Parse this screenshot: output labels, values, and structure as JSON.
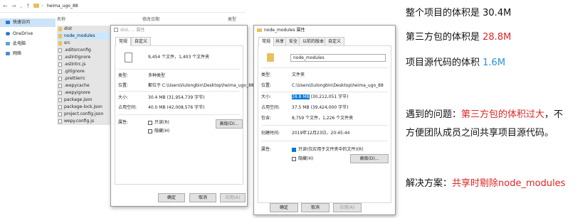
{
  "explorer": {
    "path": "heima_ugo_88",
    "columns": [
      "名称",
      "修改日期",
      "类型"
    ],
    "nav": [
      {
        "label": "快速访问",
        "color": "#2b79d0"
      },
      {
        "label": "OneDrive",
        "color": "#2b79d0"
      },
      {
        "label": "此电脑",
        "color": "#5aa0e6"
      },
      {
        "label": "网络",
        "color": "#4a8bd6"
      }
    ],
    "files": [
      {
        "name": "dist",
        "kind": "folder"
      },
      {
        "name": "node_modules",
        "kind": "folder"
      },
      {
        "name": "src",
        "kind": "folder"
      },
      {
        "name": ".editorconfig",
        "kind": "file"
      },
      {
        "name": ".eslintignore",
        "kind": "file"
      },
      {
        "name": ".eslintrc.js",
        "kind": "file"
      },
      {
        "name": ".gitignore",
        "kind": "file"
      },
      {
        "name": ".prettierrc",
        "kind": "file"
      },
      {
        "name": ".wepycache",
        "kind": "file"
      },
      {
        "name": ".wepyignore",
        "kind": "file"
      },
      {
        "name": "package.json",
        "kind": "file"
      },
      {
        "name": "package-lock.json",
        "kind": "file"
      },
      {
        "name": "project.config.json",
        "kind": "file"
      },
      {
        "name": "wepy.config.js",
        "kind": "file"
      }
    ]
  },
  "dialog1": {
    "title": "dist, ... 属性",
    "tabs": [
      "常规",
      "自定义"
    ],
    "summary": "9,454 个文件，1,403 个文件夹",
    "type_label": "类型:",
    "type_value": "多种类型",
    "location_label": "位置:",
    "location_value": "都位于 C:\\Users\\liulongbin\\Desktop\\heima_ugo_88",
    "size_label": "大小:",
    "size_value": "30.4 MB (31,954,739 字节)",
    "disk_label": "占用空间:",
    "disk_value": "40.0 MB (42,008,576 字节)",
    "attr_label": "属性:",
    "readonly": "只读(R)",
    "hidden": "隐藏(H)",
    "advanced": "高级(D)...",
    "ok": "确定",
    "cancel": "取消",
    "apply": "应用(A)"
  },
  "dialog2": {
    "title": "node_modules 属性",
    "tabs": [
      "常规",
      "共享",
      "安全",
      "以前的版本",
      "自定义"
    ],
    "name_value": "node_modules",
    "type_label": "类型:",
    "type_value": "文件夹",
    "location_label": "位置:",
    "location_value": "C:\\Users\\liulongbin\\Desktop\\heima_ugo_88",
    "size_label": "大小:",
    "size_selected": "28.8 MB",
    "size_rest": " (30,212,051 字节)",
    "disk_label": "占用空间:",
    "disk_value": "37.5 MB (39,424,000 字节)",
    "contains_label": "包含:",
    "contains_value": "8,759 个文件，1,226 个文件夹",
    "created_label": "创建时间:",
    "created_value": "2019年12月23日，20:45:44",
    "attr_label": "属性:",
    "readonly": "只读(仅应用于文件夹中的文件)(R)",
    "hidden": "隐藏(H)",
    "advanced": "高级(D)...",
    "ok": "确定",
    "cancel": "取消",
    "apply": "应用(A)"
  },
  "notes": {
    "line1_prefix": "整个项目的体积是 ",
    "line1_value": "30.4M",
    "line2_prefix": "第三方包的体积是 ",
    "line2_value": "28.8M",
    "line3_prefix": "项目源代码的体积 ",
    "line3_value": "1.6M",
    "problem_prefix": "遇到的问题：",
    "problem_red": "第三方包的体积过大",
    "problem_rest": "，不",
    "problem_line2": "方便团队成员之间共享项目源代码。",
    "solution_prefix": "解决方案：",
    "solution_red": "共享时剔除node_modules"
  },
  "colors": {
    "red": "#e02424",
    "blue": "#2a8fd6",
    "select": "#0078d7"
  }
}
